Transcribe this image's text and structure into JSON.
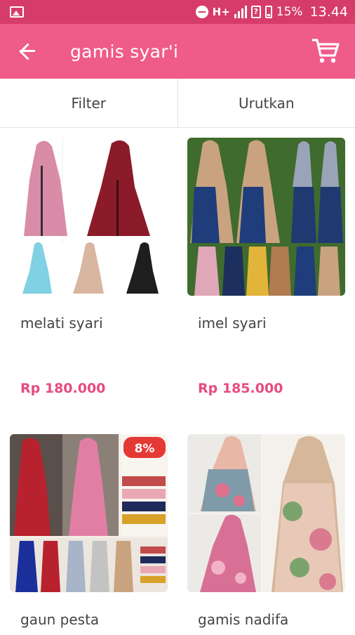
{
  "status_bar": {
    "network": "H+",
    "battery": "15%",
    "time": "13.44"
  },
  "app_bar": {
    "title": "gamis syar'i"
  },
  "tabs": {
    "filter": "Filter",
    "sort": "Urutkan"
  },
  "products": [
    {
      "name": "melati syari",
      "price": "Rp 180.000"
    },
    {
      "name": "imel syari",
      "price": "Rp 185.000"
    },
    {
      "name": "gaun pesta",
      "badge": "8%"
    },
    {
      "name": "gamis nadifa"
    }
  ],
  "colors": {
    "status_bar": "#d63c6a",
    "app_bar": "#ef5b8a",
    "price": "#e64b7f"
  }
}
